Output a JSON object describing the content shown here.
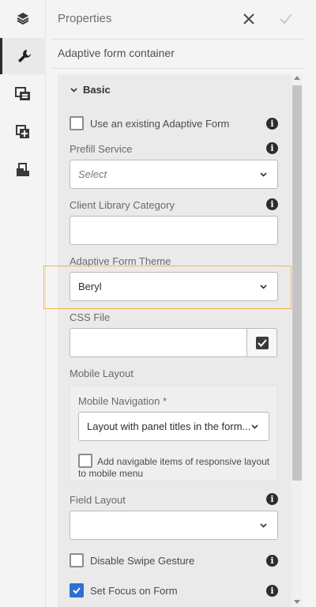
{
  "header": {
    "title": "Properties"
  },
  "subtitle": "Adaptive form container",
  "section": {
    "label": "Basic"
  },
  "existing_form": {
    "label": "Use an existing Adaptive Form",
    "checked": false
  },
  "prefill": {
    "label": "Prefill Service",
    "placeholder": "Select"
  },
  "client_library": {
    "label": "Client Library Category",
    "value": ""
  },
  "theme": {
    "label": "Adaptive Form Theme",
    "value": "Beryl"
  },
  "css_file": {
    "label": "CSS File",
    "value": ""
  },
  "mobile_layout": {
    "label": "Mobile Layout",
    "navigation_label": "Mobile Navigation *",
    "navigation_value": "Layout with panel titles in the form...",
    "navigable_items_label": "Add navigable items of responsive layout to mobile menu"
  },
  "field_layout": {
    "label": "Field Layout",
    "value": ""
  },
  "swipe": {
    "label": "Disable Swipe Gesture",
    "checked": false
  },
  "focus": {
    "label": "Set Focus on Form",
    "checked": true
  },
  "colors": {
    "accent": "#2d6fd2",
    "highlight": "#f1b54a"
  },
  "icons": {
    "rail": [
      "layers-icon",
      "wrench-icon",
      "form-container-icon",
      "add-component-icon",
      "document-stack-icon"
    ],
    "info": "info-icon",
    "close": "close-icon",
    "done": "checkmark-icon"
  }
}
